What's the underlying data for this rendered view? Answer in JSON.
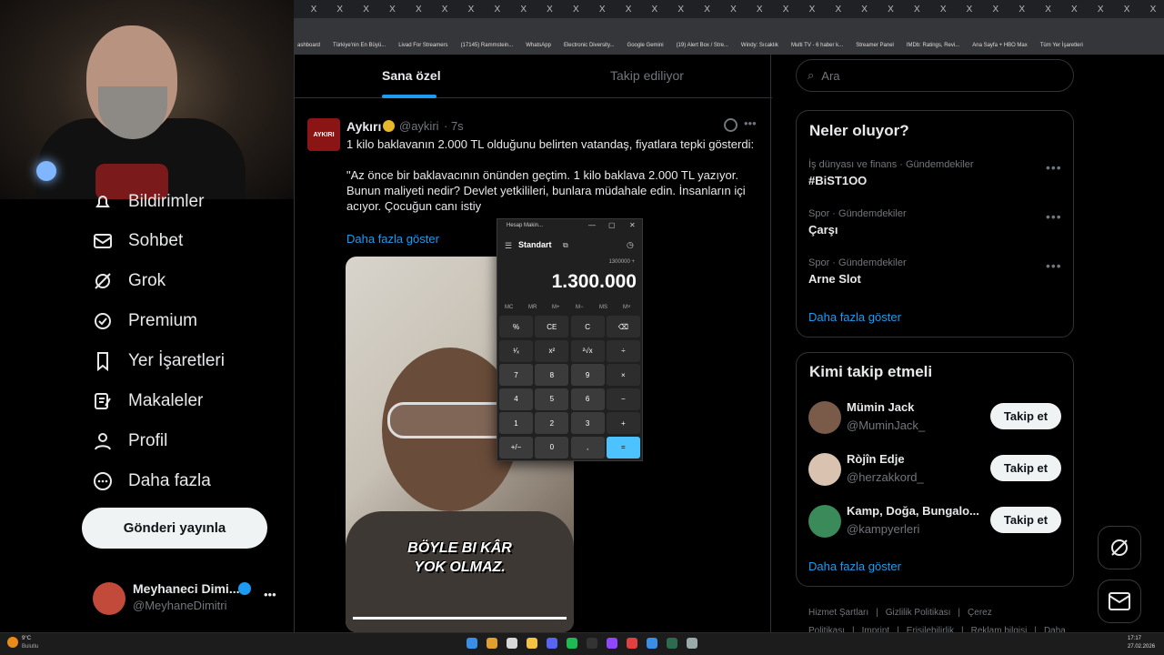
{
  "browser": {
    "tabs": [
      "X",
      "X",
      "X",
      "X",
      "X",
      "X",
      "X",
      "X",
      "X",
      "X",
      "X",
      "X",
      "X",
      "X",
      "X",
      "X",
      "X",
      "X",
      "X",
      "X",
      "X",
      "X",
      "X",
      "X",
      "X",
      "X",
      "X",
      "X",
      "X",
      "X",
      "X",
      "X",
      "X"
    ],
    "bookmarks": [
      "ashboard",
      "Türkiye'nin En Büyü...",
      "Livad For Streamers",
      "(17145) Rammstein...",
      "WhatsApp",
      "Electronic Diversity...",
      "Google Gemini",
      "(19) Alert Box / Stre...",
      "Windy: Sıcaklık",
      "Multi TV - 6 haber k...",
      "Streamer Panel",
      "IMDb: Ratings, Revi...",
      "Ana Sayfa + HBO Max",
      "Tüm Yer İşaretleri"
    ]
  },
  "sidebar": {
    "items": [
      {
        "label": "Bildirimler",
        "icon": "bell-icon"
      },
      {
        "label": "Sohbet",
        "icon": "mail-icon"
      },
      {
        "label": "Grok",
        "icon": "grok-icon"
      },
      {
        "label": "Premium",
        "icon": "verified-icon"
      },
      {
        "label": "Yer İşaretleri",
        "icon": "bookmark-icon"
      },
      {
        "label": "Makaleler",
        "icon": "article-icon"
      },
      {
        "label": "Profil",
        "icon": "person-icon"
      },
      {
        "label": "Daha fazla",
        "icon": "more-circle-icon"
      }
    ],
    "post_button": "Gönderi yayınla",
    "account": {
      "name": "Meyhaneci Dimi...",
      "handle": "@MeyhaneDimitri",
      "more": "•••"
    }
  },
  "timeline": {
    "tabs": [
      "Sana özel",
      "Takip ediliyor"
    ],
    "active_tab": "Sana özel",
    "tweet": {
      "avatar_text": "AYKIRI",
      "author": "Aykırı",
      "handle": "@aykiri",
      "time": "· 7s",
      "text": "1 kilo baklavanın 2.000 TL olduğunu belirten vatandaş, fiyatlara tepki gösterdi:\n\n\"Az önce bir baklavacının önünden geçtim. 1 kilo baklava 2.000 TL yazıyor. Bunun maliyeti nedir? Devlet yetkilileri, bunlara müdahale edin. İnsanların içi acıyor. Çocuğun canı istiy",
      "show_more": "Daha fazla göster",
      "video_caption_1": "BÖYLE BI KÂR",
      "video_caption_2": "YOK OLMAZ."
    }
  },
  "calculator": {
    "window_title": "Hesap Makin...",
    "mode": "Standart",
    "expression": "1300000 +",
    "display": "1.300.000",
    "memory": [
      "MC",
      "MR",
      "M+",
      "M−",
      "MS",
      "M˅"
    ],
    "keys": [
      "%",
      "CE",
      "C",
      "⌫",
      "¹⁄ₓ",
      "x²",
      "²√x",
      "÷",
      "7",
      "8",
      "9",
      "×",
      "4",
      "5",
      "6",
      "−",
      "1",
      "2",
      "3",
      "+",
      "+/−",
      "0",
      ",",
      "="
    ]
  },
  "right": {
    "search_placeholder": "Ara",
    "trends_title": "Neler oluyor?",
    "trends": [
      {
        "meta": "İş dünyası ve finans · Gündemdekiler",
        "name": "#BiST1OO"
      },
      {
        "meta": "Spor · Gündemdekiler",
        "name": "Çarşı"
      },
      {
        "meta": "Spor · Gündemdekiler",
        "name": "Arne Slot"
      }
    ],
    "trends_more": "Daha fazla göster",
    "follow_title": "Kimi takip etmeli",
    "follow": [
      {
        "name": "Mümin Jack",
        "handle": "@MuminJack_",
        "button": "Takip et"
      },
      {
        "name": "Ròjîn Edje",
        "handle": "@herzakkord_",
        "button": "Takip et"
      },
      {
        "name": "Kamp, Doğa, Bungalo...",
        "handle": "@kampyerleri",
        "button": "Takip et"
      }
    ],
    "follow_more": "Daha fazla göster",
    "footer": [
      "Hizmet Şartları",
      "|",
      "Gizlilik Politikası",
      "|",
      "Çerez Politikası",
      "|",
      "Imprint",
      "|",
      "Erişilebilirlik",
      "|",
      "Reklam bilgisi",
      "|",
      "Daha fazla ..."
    ]
  },
  "taskbar": {
    "weather_temp": "9°C",
    "weather_desc": "Bulutlu",
    "time": "17:17",
    "date": "27.02.2026"
  },
  "colors": {
    "accent": "#1d9bf0",
    "calc_equals": "#4cc2ff",
    "verified": "#e8b82a"
  }
}
